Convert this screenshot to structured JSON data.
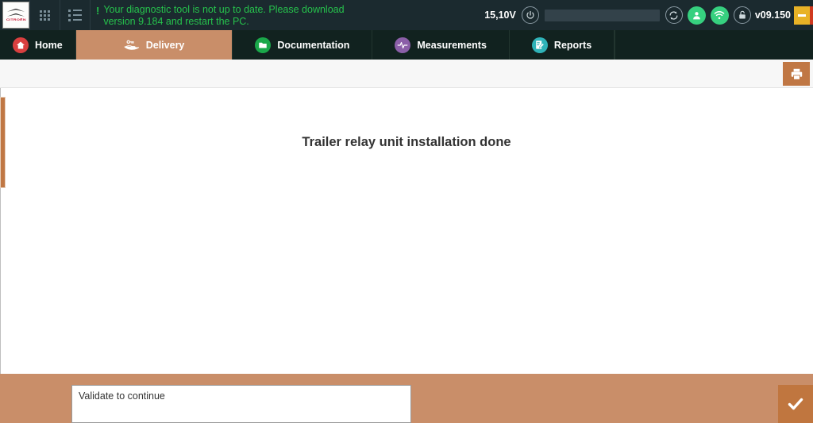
{
  "header": {
    "brand": {
      "name": "citroen-logo",
      "wordmark": "CITROËN"
    },
    "grid_icon": "grid-icon",
    "list_icon": "list-icon",
    "warning": {
      "marker": "!",
      "text": "Your diagnostic tool is not up to date. Please download version 9.184 and restart the PC."
    },
    "voltage": "15,10V",
    "power_icon": "power-icon",
    "vehicle_id_field": "",
    "refresh_icon": "refresh-icon",
    "user_icon": "user-icon",
    "wifi_icon": "wifi-icon",
    "lock_icon": "unlock-icon",
    "version": "v09.150",
    "minimize_label": "minimize-button",
    "close_label": "close-button"
  },
  "nav": {
    "tabs": [
      {
        "label": "Home",
        "icon": "home-icon",
        "active": false
      },
      {
        "label": "Delivery",
        "icon": "delivery-hand-icon",
        "active": true
      },
      {
        "label": "Documentation",
        "icon": "folder-icon",
        "active": false
      },
      {
        "label": "Measurements",
        "icon": "waveform-icon",
        "active": false
      },
      {
        "label": "Reports",
        "icon": "report-pencil-icon",
        "active": false
      }
    ]
  },
  "toolbar": {
    "print_label": "print-button"
  },
  "content": {
    "heading": "Trailer relay unit installation done",
    "side_handle": "side-panel-handle"
  },
  "footer": {
    "message": "Validate to continue",
    "validate_label": "validate-button"
  },
  "colors": {
    "header_bg": "#1b2a2f",
    "nav_bg": "#11221f",
    "accent_tan": "#c98e69",
    "accent_orange": "#c0763f",
    "warning_green": "#26c24c",
    "status_green": "#36d07f",
    "minimize_yellow": "#e8b226",
    "close_red": "#d0391f"
  }
}
